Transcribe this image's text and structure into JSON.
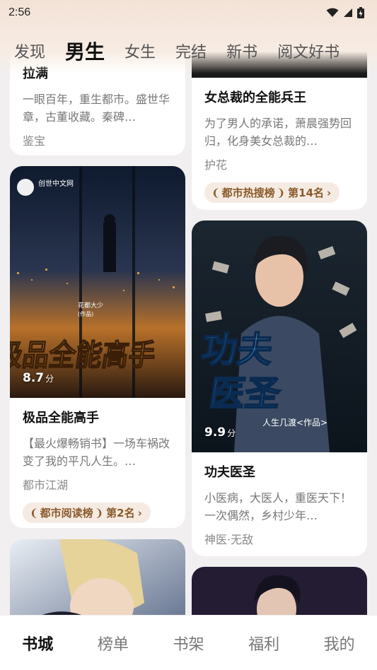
{
  "status": {
    "time": "2:56"
  },
  "tabs": [
    "发现",
    "男生",
    "女生",
    "完结",
    "新书",
    "阅文好书"
  ],
  "cards": {
    "c1": {
      "title": "拉满",
      "desc": "一眼百年，重生都市。盛世华章，古董收藏。秦碑…",
      "tags": "鉴宝"
    },
    "c2": {
      "title": "女总裁的全能兵王",
      "desc": "为了男人的承诺，萧晨强势回归，化身美女总裁的…",
      "tags": "护花",
      "rank": "都市热搜榜",
      "rank_pos": "第14名"
    },
    "c3": {
      "title": "极品全能高手",
      "desc": "【最火爆畅销书】一场车祸改变了我的平凡人生。…",
      "tags": "都市江湖",
      "rank": "都市阅读榜",
      "rank_pos": "第2名",
      "rating": "8.7",
      "rating_unit": "分",
      "cover_title": "极品全能高手",
      "cover_author": "花都大少",
      "cover_author_suffix": "(作品)",
      "cover_logo": "创世中文网"
    },
    "c4": {
      "title": "功夫医圣",
      "desc": "小医病，大医人，重医天下！一次偶然，乡村少年…",
      "tags": "神医·无敌",
      "rating": "9.9",
      "rating_unit": "分",
      "cover_title_line1": "功夫",
      "cover_title_line2": "医圣",
      "cover_author": "人生几渡<作品>"
    }
  },
  "bottom_nav": [
    "书城",
    "榜单",
    "书架",
    "福利",
    "我的"
  ]
}
